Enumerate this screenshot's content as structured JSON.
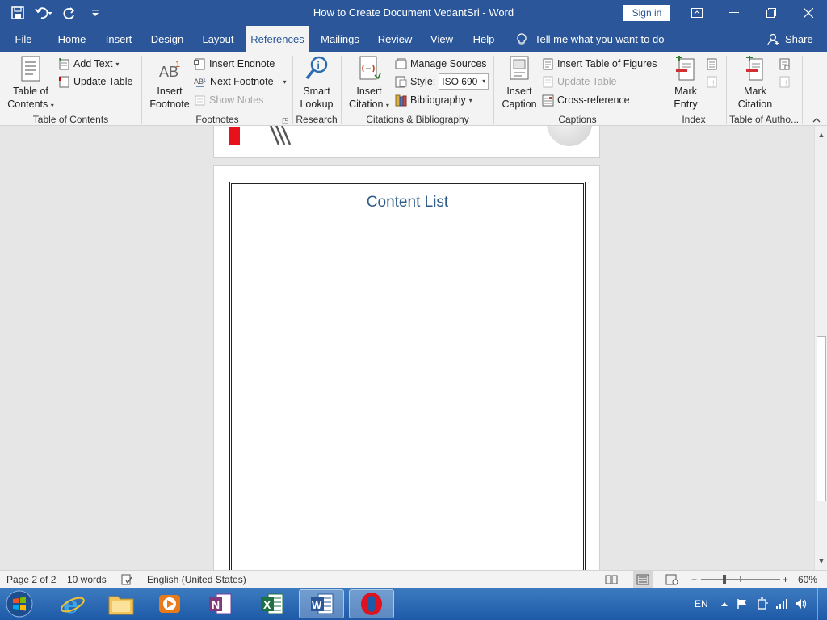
{
  "titlebar": {
    "title": "How to Create Document VedantSri  -  Word",
    "signin": "Sign in"
  },
  "qat": {
    "icons": [
      "save-icon",
      "undo-icon",
      "redo-icon",
      "customize-icon"
    ]
  },
  "tabs": [
    {
      "label": "File"
    },
    {
      "label": "Home"
    },
    {
      "label": "Insert"
    },
    {
      "label": "Design"
    },
    {
      "label": "Layout"
    },
    {
      "label": "References",
      "active": true
    },
    {
      "label": "Mailings"
    },
    {
      "label": "Review"
    },
    {
      "label": "View"
    },
    {
      "label": "Help"
    }
  ],
  "tellme": "Tell me what you want to do",
  "share": "Share",
  "ribbon": {
    "toc": {
      "big_label_1": "Table of",
      "big_label_2": "Contents",
      "add_text": "Add Text",
      "update_table": "Update Table",
      "group": "Table of Contents"
    },
    "footnotes": {
      "big_label_1": "Insert",
      "big_label_2": "Footnote",
      "insert_endnote": "Insert Endnote",
      "next_footnote": "Next Footnote",
      "show_notes": "Show Notes",
      "group": "Footnotes"
    },
    "research": {
      "big_label_1": "Smart",
      "big_label_2": "Lookup",
      "group": "Research"
    },
    "citations": {
      "big_label_1": "Insert",
      "big_label_2": "Citation",
      "manage_sources": "Manage Sources",
      "style_label": "Style:",
      "style_value": "ISO 690",
      "bibliography": "Bibliography",
      "group": "Citations & Bibliography"
    },
    "captions": {
      "big_label_1": "Insert",
      "big_label_2": "Caption",
      "insert_tof": "Insert Table of Figures",
      "update_table": "Update Table",
      "cross_ref": "Cross-reference",
      "group": "Captions"
    },
    "index": {
      "big_label_1": "Mark",
      "big_label_2": "Entry",
      "group": "Index"
    },
    "toa": {
      "big_label_1": "Mark",
      "big_label_2": "Citation",
      "group": "Table of Autho..."
    }
  },
  "document": {
    "content_title": "Content List"
  },
  "statusbar": {
    "page": "Page 2 of 2",
    "words": "10 words",
    "language": "English (United States)",
    "zoom": "60%",
    "zoom_fraction": 0.6
  },
  "taskbar": {
    "apps": [
      "internet-explorer-icon",
      "file-explorer-icon",
      "media-player-icon",
      "onenote-icon",
      "excel-icon",
      "word-icon",
      "opera-icon"
    ],
    "tray_lang": "EN"
  },
  "colors": {
    "word_blue": "#2b579a",
    "ribbon_bg": "#f3f3f3",
    "heading_blue": "#2e5c8a"
  }
}
